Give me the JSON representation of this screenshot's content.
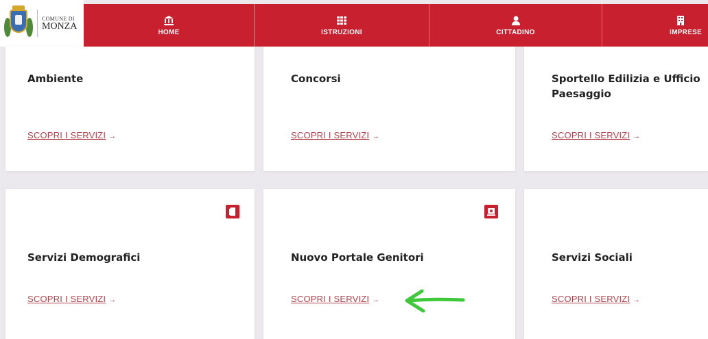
{
  "header": {
    "logo_small": "COMUNE DI",
    "logo_big": "MONZA",
    "nav": [
      {
        "label": "HOME",
        "icon": "bank-icon"
      },
      {
        "label": "ISTRUZIONI",
        "icon": "grid-icon"
      },
      {
        "label": "CITTADINO",
        "icon": "person-icon"
      },
      {
        "label": "IMPRESE",
        "icon": "building-icon"
      }
    ]
  },
  "cards": [
    {
      "title": "Ambiente",
      "link": "SCOPRI I SERVIZI"
    },
    {
      "title": "Concorsi",
      "link": "SCOPRI I SERVIZI"
    },
    {
      "title": "Sportello Edilizia e Ufficio Paesaggio",
      "link": "SCOPRI I SERVIZI"
    },
    {
      "title": "Servizi Demografici",
      "link": "SCOPRI I SERVIZI",
      "badge": "document-icon"
    },
    {
      "title": "Nuovo Portale Genitori",
      "link": "SCOPRI I SERVIZI",
      "badge": "portal-icon"
    },
    {
      "title": "Servizi Sociali",
      "link": "SCOPRI I SERVIZI"
    }
  ],
  "colors": {
    "accent": "#c8202f",
    "link": "#b3434d",
    "annotation_arrow": "#3fc93a"
  },
  "arrow_glyph": "→"
}
